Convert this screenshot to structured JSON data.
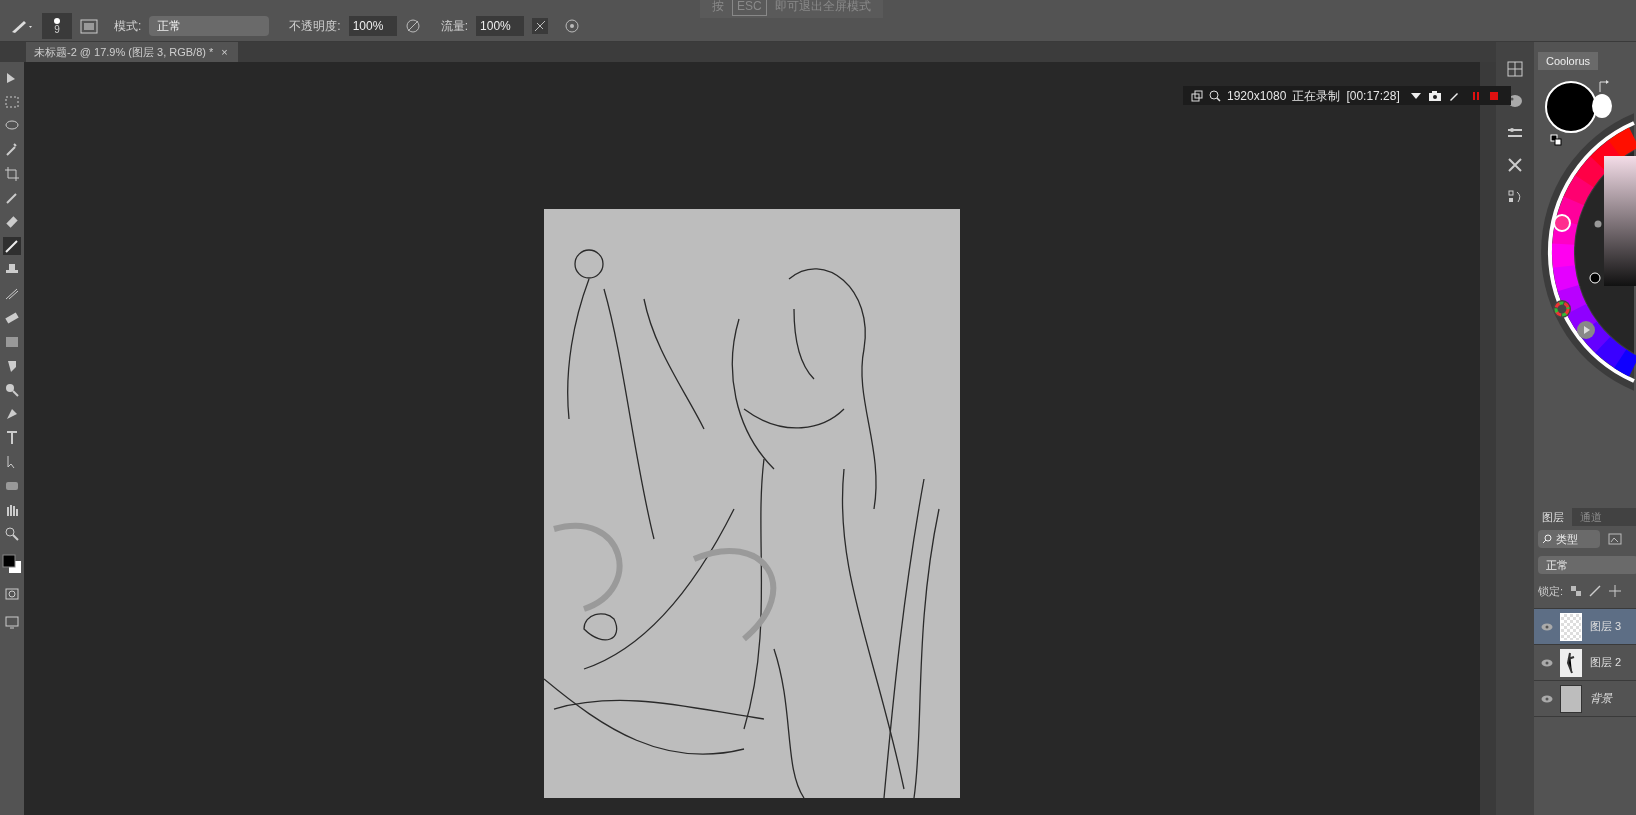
{
  "fullscreen_hint": {
    "prefix": "按",
    "key": "ESC",
    "suffix": "即可退出全屏模式"
  },
  "options_bar": {
    "brush_size": "9",
    "mode_label": "模式:",
    "mode_value": "正常",
    "opacity_label": "不透明度:",
    "opacity_value": "100%",
    "flow_label": "流量:",
    "flow_value": "100%"
  },
  "document_tab": {
    "title": "未标题-2 @ 17.9% (图层 3, RGB/8) *",
    "close": "×"
  },
  "tools": [
    {
      "selected": false
    },
    {
      "selected": false
    },
    {
      "selected": false
    },
    {
      "selected": false
    },
    {
      "selected": false
    },
    {
      "selected": false
    },
    {
      "selected": false
    },
    {
      "selected": true
    },
    {
      "selected": false
    },
    {
      "selected": false
    },
    {
      "selected": false
    },
    {
      "selected": false
    },
    {
      "selected": false
    },
    {
      "selected": false
    },
    {
      "selected": false
    },
    {
      "selected": false
    },
    {
      "selected": false
    },
    {
      "selected": false
    },
    {
      "selected": false
    },
    {
      "selected": false
    }
  ],
  "recorder": {
    "resolution": "1920x1080",
    "status": "正在录制",
    "elapsed": "[00:17:28]"
  },
  "coolorus": {
    "tab": "Coolorus"
  },
  "layers_panel": {
    "tabs": [
      {
        "label": "图层",
        "selected": true
      },
      {
        "label": "通道",
        "selected": false
      }
    ],
    "filter": "类型",
    "blend_mode": "正常",
    "lock_label": "锁定:",
    "layers": [
      {
        "name": "图层 3",
        "kind": "transparent",
        "visible": true,
        "selected": true
      },
      {
        "name": "图层 2",
        "kind": "figure",
        "visible": true,
        "selected": false
      },
      {
        "name": "背景",
        "kind": "fill",
        "visible": true,
        "selected": false
      }
    ]
  }
}
